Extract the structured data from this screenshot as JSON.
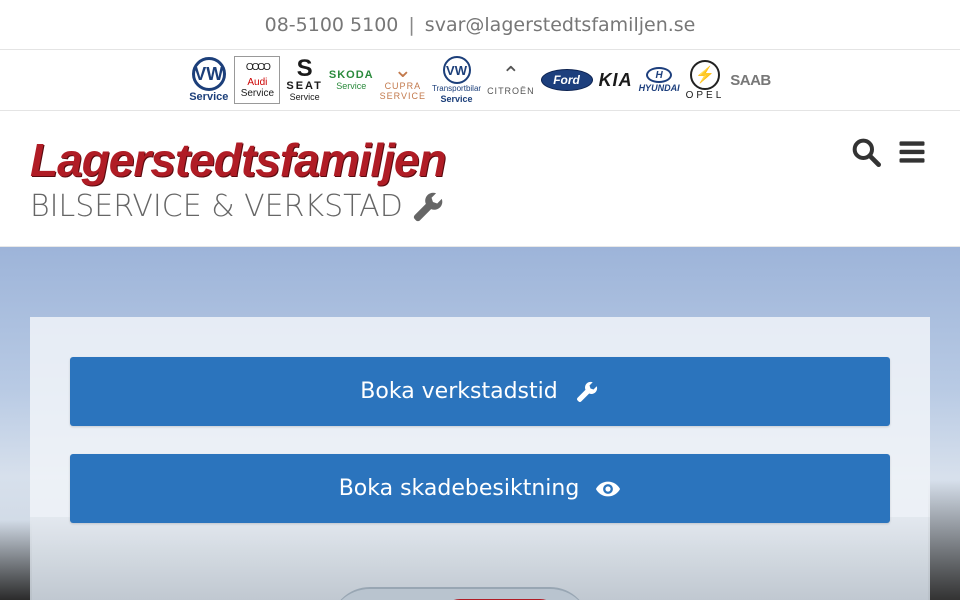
{
  "topbar": {
    "phone": "08-5100 5100",
    "separator": "|",
    "email": "svar@lagerstedtsfamiljen.se"
  },
  "brands": {
    "vw": {
      "mark": "VW",
      "label": "Service"
    },
    "audi": {
      "rings": "OOOO",
      "label1": "Audi",
      "label2": "Service"
    },
    "seat": {
      "mark": "S",
      "label1": "SEAT",
      "label2": "Service"
    },
    "skoda": {
      "label1": "SKODA",
      "label2": "Service"
    },
    "cupra": {
      "mark": "⌄",
      "label1": "CUPRA",
      "label2": "SERVICE"
    },
    "vw_transport": {
      "mark": "VW",
      "label1": "Transportbilar",
      "label2": "Service"
    },
    "citroen": {
      "mark": "⌃",
      "label": "CITROËN"
    },
    "ford": {
      "label": "Ford"
    },
    "kia": {
      "label": "KIA"
    },
    "hyundai": {
      "mark": "H",
      "label": "HYUNDAI"
    },
    "opel": {
      "mark": "⚡",
      "label": "OPEL"
    },
    "saab": {
      "label": "SAAB"
    }
  },
  "header": {
    "logo": "Lagerstedtsfamiljen",
    "tagline": "BILSERVICE & VERKSTAD"
  },
  "icons": {
    "search": "search-icon",
    "menu": "hamburger-menu-icon",
    "wrench": "wrench-icon",
    "eye": "eye-icon"
  },
  "colors": {
    "accent_blue": "#2b74bd",
    "brand_red": "#b01c25"
  },
  "hero": {
    "buttons": [
      {
        "label": "Boka verkstadstid",
        "icon": "wrench-icon"
      },
      {
        "label": "Boka skadebesiktning",
        "icon": "eye-icon"
      }
    ]
  }
}
